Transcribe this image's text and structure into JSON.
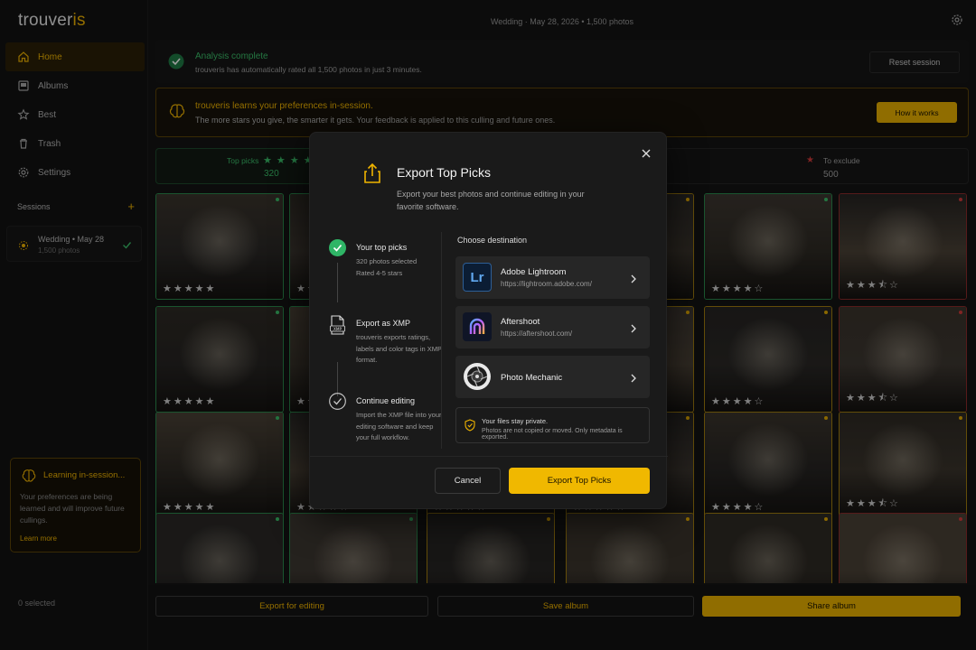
{
  "app": {
    "logo_main": "trouver",
    "logo_accent": "is"
  },
  "sidebar": {
    "items": [
      {
        "label": "Home",
        "icon": "home-icon"
      },
      {
        "label": "Albums",
        "icon": "albums-icon"
      },
      {
        "label": "Best",
        "icon": "star-icon"
      },
      {
        "label": "Trash",
        "icon": "trash-icon"
      },
      {
        "label": "Settings",
        "icon": "gear-icon"
      }
    ],
    "sessions_label": "Sessions",
    "sessions_add": "+",
    "session": {
      "title": "Wedding • May 28",
      "subtitle": "1,500 photos"
    },
    "learning": {
      "title": "Learning in-session...",
      "body": "Your preferences are being learned and will improve future cullings.",
      "link": "Learn more"
    },
    "selected": "0 selected"
  },
  "header": {
    "info": "Wedding  ·  May 28, 2026 • 1,500 photos"
  },
  "banner_analysis": {
    "title": "Analysis complete",
    "subtitle": "trouveris has automatically rated all 1,500 photos in just 3 minutes.",
    "reset_label": "Reset session"
  },
  "banner_learn": {
    "title": "trouveris learns your preferences in-session.",
    "subtitle": "The more stars you give, the smarter it gets. Your feedback is applied to this culling and future ones.",
    "how_label": "How it works"
  },
  "filters": {
    "top_label": "Top picks",
    "top_stars": "★ ★ ★ ★",
    "top_count": "320",
    "exclude_label": "To exclude",
    "exclude_star": "★",
    "exclude_count": "500"
  },
  "photos": [
    {
      "rating": "★★★★★",
      "border": "green",
      "dot": "#3bbf6a",
      "scene": "a"
    },
    {
      "rating": "★★★★★",
      "border": "green",
      "dot": "#3bbf6a",
      "scene": "b"
    },
    {
      "rating": "★★★★☆",
      "border": "green",
      "dot": "#3bbf6a",
      "scene": "c"
    },
    {
      "rating": "★★★★☆",
      "border": "green",
      "dot": "#3bbf6a",
      "scene": "d"
    },
    {
      "rating": "★★★★☆",
      "border": "green",
      "dot": "#3bbf6a",
      "scene": "e"
    },
    {
      "rating": "★★★★☆",
      "border": "green",
      "dot": "#3bbf6a",
      "scene": "f"
    },
    {
      "rating": "★★★⯪☆",
      "border": "red",
      "dot": "#d13b3b",
      "scene": "g"
    }
  ],
  "bottom": {
    "export_label": "Export for editing",
    "save_label": "Save album",
    "share_label": "Share album"
  },
  "modal": {
    "title": "Export Top Picks",
    "subtitle": "Export your best photos and continue editing in your favorite software.",
    "steps": [
      {
        "title": "Your top picks",
        "body": "320 photos selected\nRated 4-5 stars"
      },
      {
        "title": "Export as XMP",
        "body": "trouveris exports ratings, labels and color tags in XMP format."
      },
      {
        "title": "Continue editing",
        "body": "Import the XMP file into your editing software and keep your full workflow."
      }
    ],
    "xmp_tag": "XMP",
    "dest_head": "Choose destination",
    "destinations": [
      {
        "name": "Adobe Lightroom",
        "url": "https://lightroom.adobe.com/",
        "badge": "Lr"
      },
      {
        "name": "Aftershoot",
        "url": "https://aftershoot.com/",
        "badge": ""
      },
      {
        "name": "Photo Mechanic",
        "url": "",
        "badge": ""
      }
    ],
    "privacy_title": "Your files stay private.",
    "privacy_body": "Photos are not copied or moved. Only metadata is exported.",
    "cancel_label": "Cancel",
    "export_label": "Export Top Picks"
  }
}
